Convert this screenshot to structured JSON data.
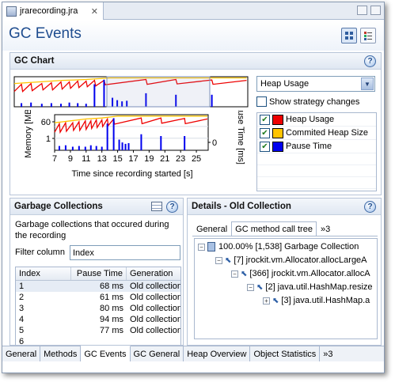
{
  "editor_tab": {
    "label": "jrarecording.jra",
    "close": "✕"
  },
  "page": {
    "title": "GC Events"
  },
  "icons": {
    "view_mode_1": "view-mode-grid-icon",
    "view_mode_2": "view-mode-list-icon"
  },
  "gc_chart": {
    "section_title": "GC Chart",
    "help": "?",
    "dropdown_value": "Heap Usage",
    "strategy_label": "Show strategy changes",
    "legend": [
      {
        "label": "Heap Usage",
        "color": "#ee0000",
        "checked": true
      },
      {
        "label": "Commited Heap Size",
        "color": "#ffc400",
        "checked": true
      },
      {
        "label": "Pause Time",
        "color": "#0000ee",
        "checked": true
      }
    ]
  },
  "chart_data": {
    "type": "line",
    "xlabel": "Time since recording started [s]",
    "ylabel": "Memory [MB]",
    "y2label": "Pause Time [ms]",
    "x_ticks": [
      "7",
      "9",
      "11",
      "13",
      "15",
      "17",
      "19",
      "21",
      "23",
      "25"
    ],
    "y_ticks": [
      "60",
      "1"
    ],
    "y2_ticks": [
      "0"
    ],
    "xlim": [
      7,
      26.5
    ],
    "ylim": [
      0,
      75
    ],
    "y2lim": [
      0,
      100
    ],
    "series": [
      {
        "name": "Heap Usage",
        "color": "#ee0000",
        "x": [
          7,
          7.6,
          7.7,
          8.4,
          8.5,
          9.3,
          9.4,
          10.1,
          10.2,
          10.9,
          11.0,
          11.6,
          11.7,
          12.3,
          12.4,
          13.0,
          13.1,
          13.7,
          13.8,
          14.5,
          14.6,
          18.0,
          18.1,
          20.5,
          20.6,
          23.5,
          23.6,
          26.4
        ],
        "y": [
          38,
          56,
          38,
          58,
          40,
          58,
          42,
          60,
          42,
          62,
          44,
          62,
          46,
          64,
          48,
          64,
          50,
          66,
          52,
          66,
          55,
          68,
          56,
          68,
          57,
          67,
          56,
          66
        ]
      },
      {
        "name": "Commited Heap Size",
        "color": "#ffc400",
        "x": [
          7,
          8,
          9,
          10,
          11,
          12,
          13,
          14,
          14.5,
          15,
          26.4
        ],
        "y": [
          58,
          60,
          62,
          64,
          66,
          67,
          68,
          70,
          71,
          72,
          72
        ]
      },
      {
        "name": "Pause Time",
        "color": "#0000ee",
        "x": [
          7.6,
          8.4,
          9.3,
          10.1,
          10.9,
          11.6,
          12.3,
          13.0,
          13.7,
          14.5,
          15.2,
          15.6,
          16.0,
          16.4,
          18.0,
          20.5,
          23.5
        ],
        "y": [
          12,
          14,
          10,
          12,
          10,
          14,
          12,
          10,
          75,
          90,
          30,
          22,
          18,
          20,
          45,
          40,
          40
        ]
      }
    ]
  },
  "garbage_collections": {
    "section_title": "Garbage Collections",
    "description": "Garbage collections that occured during the recording",
    "filter_label": "Filter column",
    "filter_value": "Index",
    "columns": [
      "Index",
      "Pause Time",
      "Generation"
    ],
    "rows": [
      [
        "1",
        "68 ms",
        "Old collection"
      ],
      [
        "2",
        "61 ms",
        "Old collection"
      ],
      [
        "3",
        "80 ms",
        "Old collection"
      ],
      [
        "4",
        "94 ms",
        "Old collection"
      ],
      [
        "5",
        "77 ms",
        "Old collection"
      ],
      [
        "6",
        "",
        ""
      ]
    ]
  },
  "details": {
    "section_title": "Details - Old Collection",
    "tabs": [
      "General",
      "GC method call tree"
    ],
    "overflow": "»3",
    "tree": [
      "100.00% [1,538] Garbage Collection",
      "[7] jrockit.vm.Allocator.allocLargeA",
      "[366] jrockit.vm.Allocator.allocA",
      "[2] java.util.HashMap.resize",
      "[3] java.util.HashMap.a"
    ]
  },
  "bottom_tabs": [
    "General",
    "Methods",
    "GC Events",
    "GC General",
    "Heap Overview",
    "Object Statistics"
  ],
  "bottom_overflow": "»3"
}
